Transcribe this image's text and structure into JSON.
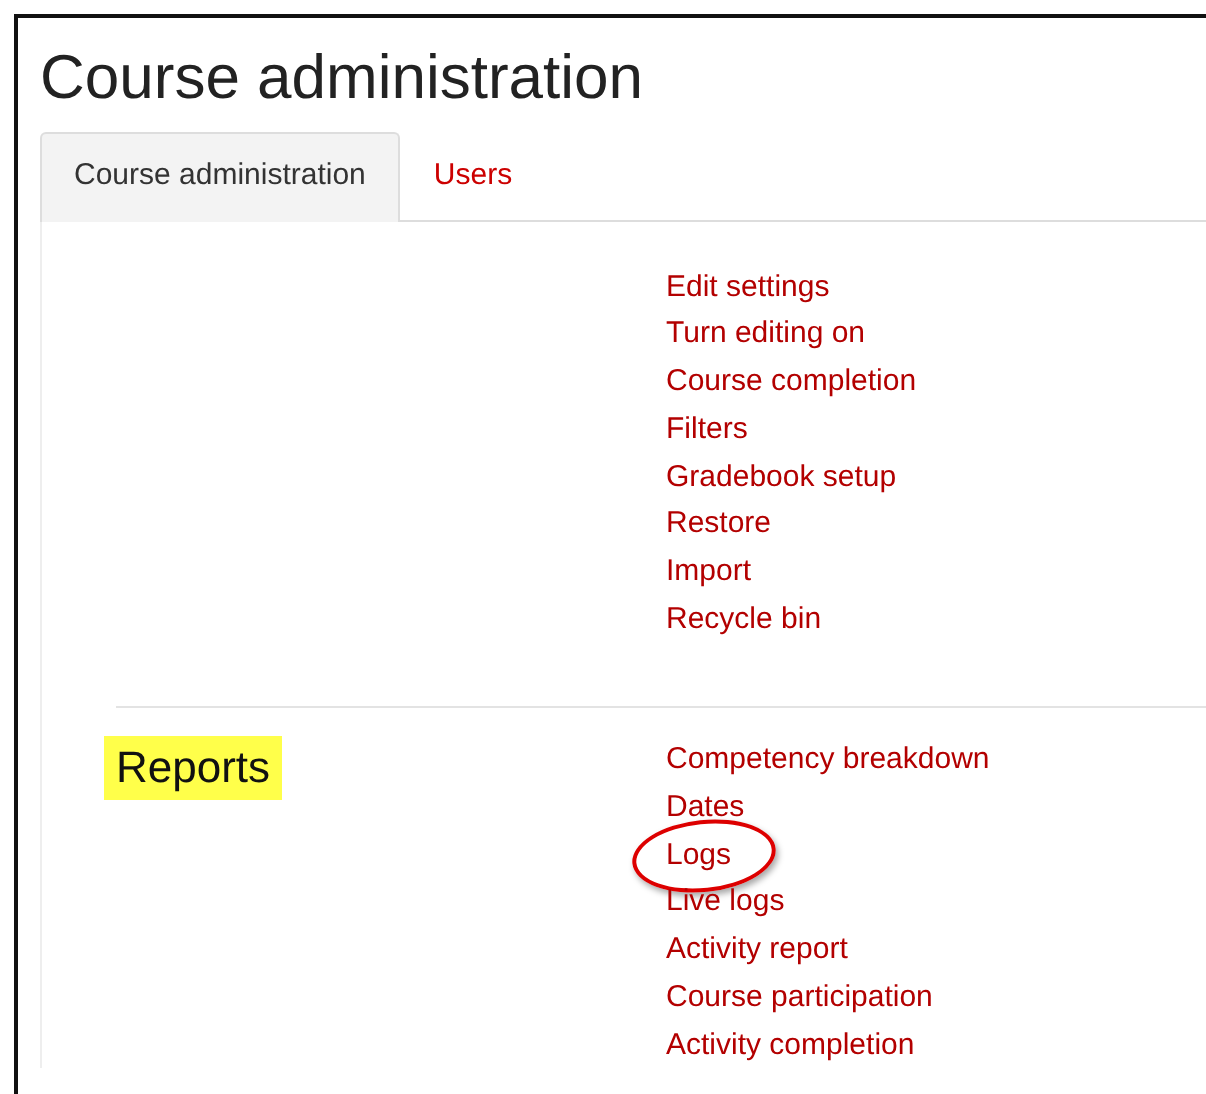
{
  "page_title": "Course administration",
  "tabs": [
    {
      "label": "Course administration",
      "selected": true
    },
    {
      "label": "Users",
      "selected": false
    }
  ],
  "sections": [
    {
      "links": [
        {
          "label": "Edit settings",
          "circled": false
        },
        {
          "label": "Turn editing on",
          "circled": false
        },
        {
          "label": "Course completion",
          "circled": false
        },
        {
          "label": "Filters",
          "circled": false
        },
        {
          "label": "Gradebook setup",
          "circled": false
        },
        {
          "label": "Restore",
          "circled": false
        },
        {
          "label": "Import",
          "circled": false
        },
        {
          "label": "Recycle bin",
          "circled": false
        }
      ]
    },
    {
      "heading": "Reports",
      "highlighted": true,
      "links": [
        {
          "label": "Competency breakdown",
          "circled": false
        },
        {
          "label": "Dates",
          "circled": false
        },
        {
          "label": "Logs",
          "circled": true
        },
        {
          "label": "Live logs",
          "circled": false
        },
        {
          "label": "Activity report",
          "circled": false
        },
        {
          "label": "Course participation",
          "circled": false
        },
        {
          "label": "Activity completion",
          "circled": false
        }
      ]
    }
  ]
}
